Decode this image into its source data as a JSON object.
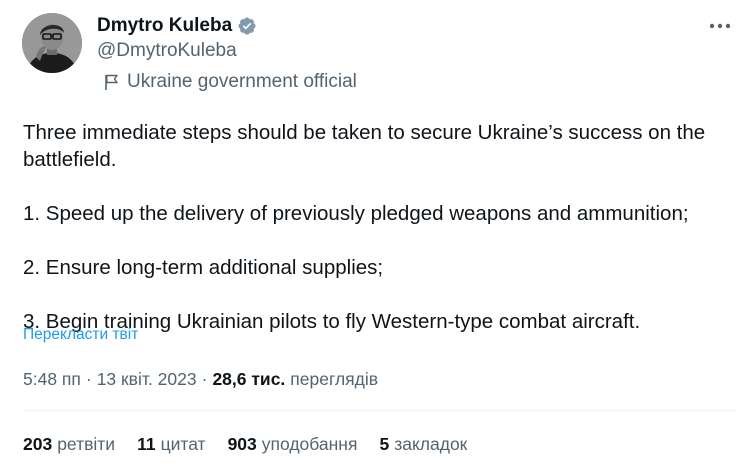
{
  "author": {
    "display_name": "Dmytro Kuleba",
    "handle": "@DmytroKuleba",
    "affiliation_label": "Ukraine government official",
    "verified_icon": "verified-badge-icon",
    "verified_color": "#829aab"
  },
  "tweet": {
    "paragraphs": [
      "Three immediate steps should be taken to secure Ukraine’s success on the battlefield.",
      "1. Speed up the delivery of previously pledged weapons and ammunition;",
      "2. Ensure long-term additional supplies;",
      "3. Begin training Ukrainian pilots to fly Western-type combat aircraft."
    ],
    "translate_label": "Перекласти твіт"
  },
  "meta": {
    "time": "5:48 пп",
    "separator": "·",
    "date": "13 квіт. 2023",
    "views_count": "28,6 тис.",
    "views_label": "переглядів"
  },
  "stats": {
    "retweets": {
      "count": "203",
      "label": "ретвіти"
    },
    "quotes": {
      "count": "11",
      "label": "цитат"
    },
    "likes": {
      "count": "903",
      "label": "уподобання"
    },
    "bookmarks": {
      "count": "5",
      "label": "закладок"
    }
  },
  "colors": {
    "link": "#1d9bf0",
    "secondary_text": "#536471",
    "primary_text": "#0f1419"
  }
}
